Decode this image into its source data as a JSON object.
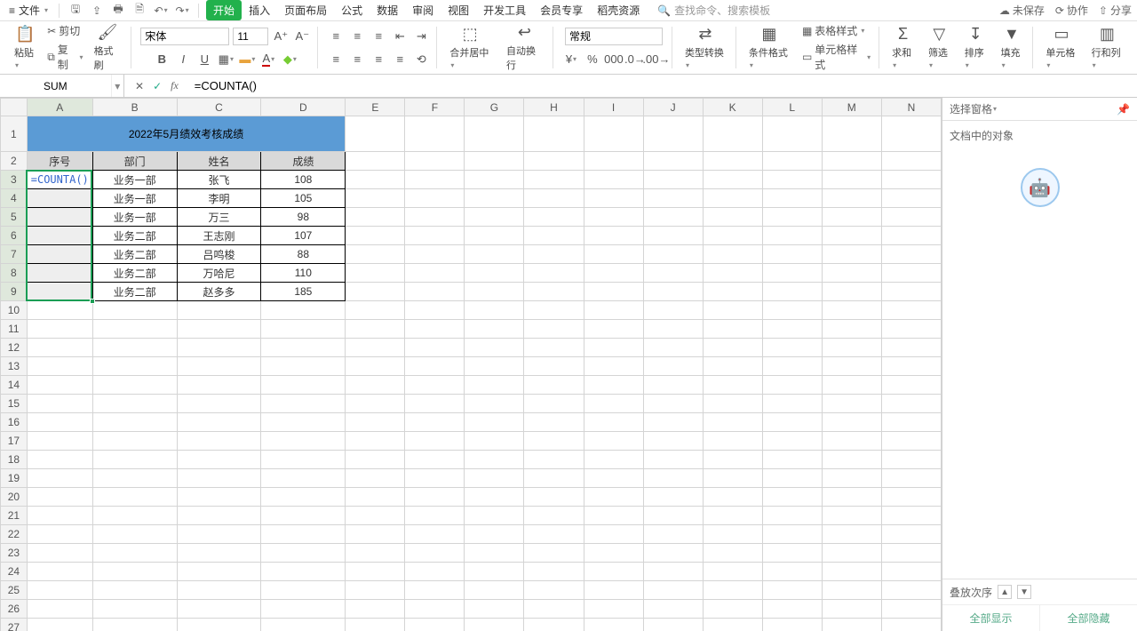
{
  "menu": {
    "file": "文件",
    "tabs": [
      "开始",
      "插入",
      "页面布局",
      "公式",
      "数据",
      "审阅",
      "视图",
      "开发工具",
      "会员专享",
      "稻壳资源"
    ],
    "search_placeholder": "查找命令、搜索模板",
    "unsaved": "未保存",
    "coop": "协作",
    "share": "分享"
  },
  "ribbon": {
    "paste": "粘贴",
    "cut": "剪切",
    "copy": "复制",
    "format_painter": "格式刷",
    "font_name": "宋体",
    "font_size": "11",
    "merge_center": "合并居中",
    "wrap_text": "自动换行",
    "number_format": "常规",
    "type_convert": "类型转换",
    "cond_format": "条件格式",
    "table_style": "表格样式",
    "cell_style": "单元格样式",
    "sum": "求和",
    "filter": "筛选",
    "sort": "排序",
    "fill": "填充",
    "cells": "单元格",
    "rowscols": "行和列"
  },
  "formula": {
    "name_box": "SUM",
    "formula_text": "=COUNTA()"
  },
  "side": {
    "select_pane": "选择窗格",
    "objects": "文档中的对象",
    "stack_order": "叠放次序",
    "show_all": "全部显示",
    "hide_all": "全部隐藏"
  },
  "cols": [
    "A",
    "B",
    "C",
    "D",
    "E",
    "F",
    "G",
    "H",
    "I",
    "J",
    "K",
    "L",
    "M",
    "N"
  ],
  "rows_shown": 27,
  "table": {
    "title": "2022年5月绩效考核成绩",
    "headers": [
      "序号",
      "部门",
      "姓名",
      "成绩"
    ],
    "editing_cell_text": "=COUNTA()",
    "rows": [
      {
        "b": "业务一部",
        "c": "张飞",
        "d": "108"
      },
      {
        "b": "业务一部",
        "c": "李明",
        "d": "105"
      },
      {
        "b": "业务一部",
        "c": "万三",
        "d": "98"
      },
      {
        "b": "业务二部",
        "c": "王志刚",
        "d": "107"
      },
      {
        "b": "业务二部",
        "c": "吕鸣梭",
        "d": "88"
      },
      {
        "b": "业务二部",
        "c": "万哈尼",
        "d": "110"
      },
      {
        "b": "业务二部",
        "c": "赵多多",
        "d": "185"
      }
    ]
  }
}
